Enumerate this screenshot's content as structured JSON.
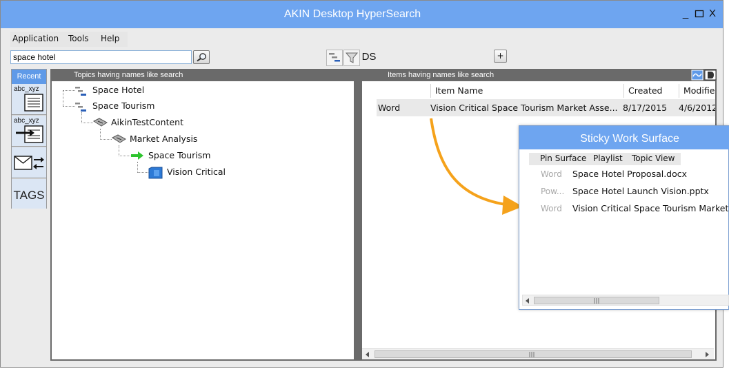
{
  "window": {
    "title": "AKIN Desktop HyperSearch",
    "minimize": "_",
    "maximize": "☐",
    "close": "X"
  },
  "menu": [
    "Application",
    "Tools",
    "Help"
  ],
  "search": {
    "value": "space hotel"
  },
  "toolbar": {
    "ds_label": "DS",
    "add_label": "+"
  },
  "sidebar": {
    "recent_label": "Recent",
    "tile1_label": "abc_xyz",
    "tile2_label": "abc_xyz",
    "tags_label": "TAGS"
  },
  "topics": {
    "header": "Topics having names like search",
    "tree": [
      {
        "label": "Space Hotel",
        "icon": "topic-bars-icon"
      },
      {
        "label": "Space Tourism",
        "icon": "topic-bars-icon"
      },
      {
        "label": "AikinTestContent",
        "icon": "folder-tag-icon"
      },
      {
        "label": "Market Analysis",
        "icon": "folder-tag-icon"
      },
      {
        "label": "Space Tourism",
        "icon": "green-arrow-icon"
      },
      {
        "label": "Vision Critical",
        "icon": "blue-document-icon"
      }
    ]
  },
  "items": {
    "header": "Items having names like search",
    "columns": [
      "Item Name",
      "Created",
      "Modified"
    ],
    "rows": [
      {
        "type": "Word",
        "name": "Vision Critical Space Tourism Market Asse...",
        "created": "8/17/2015",
        "modified": "4/6/2012"
      }
    ]
  },
  "sticky": {
    "title": "Sticky Work Surface",
    "menu": [
      "Pin Surface",
      "Playlist",
      "Topic View"
    ],
    "items": [
      {
        "type": "Word",
        "name": "Space Hotel Proposal.docx"
      },
      {
        "type": "Pow...",
        "name": "Space Hotel Launch Vision.pptx"
      },
      {
        "type": "Word",
        "name": "Vision Critical Space Tourism Market"
      }
    ]
  },
  "colors": {
    "titlebar": "#6ea5f0",
    "panel_header": "#6a6a6a",
    "accent_arrow": "#f5a21b",
    "tree_arrow": "#2ec42e"
  }
}
